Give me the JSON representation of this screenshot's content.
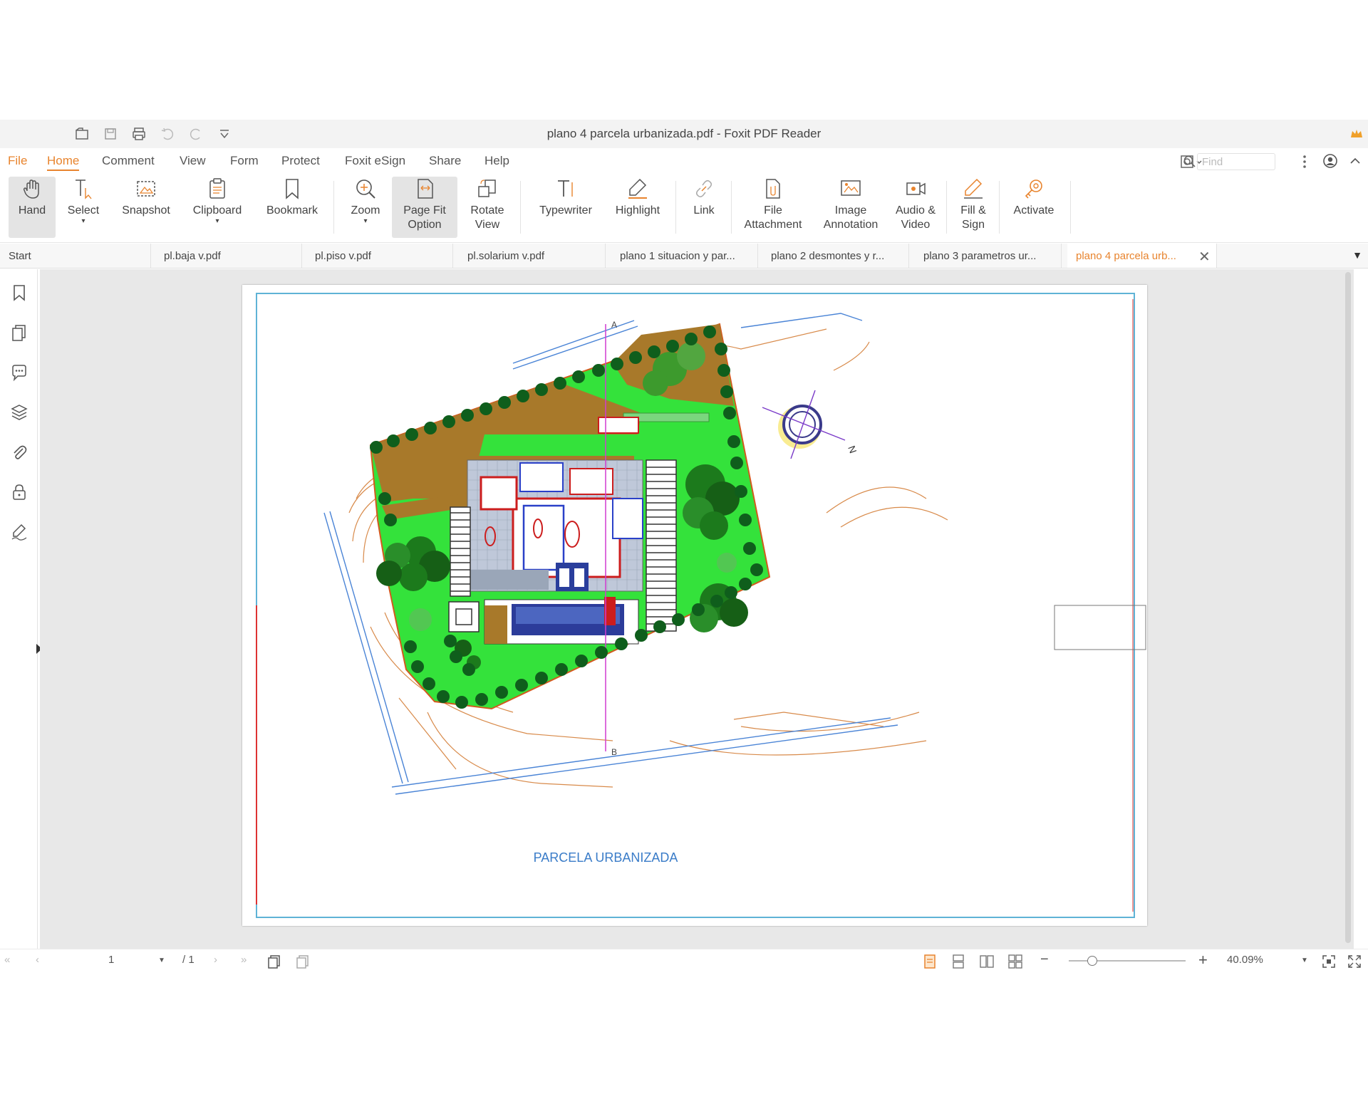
{
  "window": {
    "title": "plano 4 parcela urbanizada.pdf - Foxit PDF Reader"
  },
  "menu": {
    "file": "File",
    "home": "Home",
    "comment": "Comment",
    "view": "View",
    "form": "Form",
    "protect": "Protect",
    "esign": "Foxit eSign",
    "share": "Share",
    "help": "Help"
  },
  "search": {
    "placeholder": "Find"
  },
  "ribbon": {
    "hand": "Hand",
    "select": "Select",
    "snapshot": "Snapshot",
    "clipboard": "Clipboard",
    "bookmark": "Bookmark",
    "zoom": "Zoom",
    "pagefit_1": "Page Fit",
    "pagefit_2": "Option",
    "rotate_1": "Rotate",
    "rotate_2": "View",
    "typewriter": "Typewriter",
    "highlight": "Highlight",
    "link": "Link",
    "file_1": "File",
    "file_2": "Attachment",
    "image_1": "Image",
    "image_2": "Annotation",
    "audio_1": "Audio &",
    "audio_2": "Video",
    "fill_1": "Fill &",
    "fill_2": "Sign",
    "activate": "Activate"
  },
  "tabs": [
    "Start",
    "pl.baja v.pdf",
    "pl.piso v.pdf",
    "pl.solarium v.pdf",
    "plano 1 situacion y par...",
    "plano 2 desmontes y r...",
    "plano 3  parametros ur...",
    "plano 4 parcela urb..."
  ],
  "document": {
    "plan_title": "PARCELA URBANIZADA",
    "section_a": "A",
    "section_b": "B",
    "north": "N"
  },
  "status": {
    "page_current": "1",
    "page_total": "/ 1",
    "zoom": "40.09%"
  },
  "colors": {
    "accent": "#e8842e",
    "plot_green": "#33e03a",
    "tree_dark": "#1a6e1a",
    "wood": "#a8792a",
    "drawing_blue": "#2a6ad8"
  }
}
